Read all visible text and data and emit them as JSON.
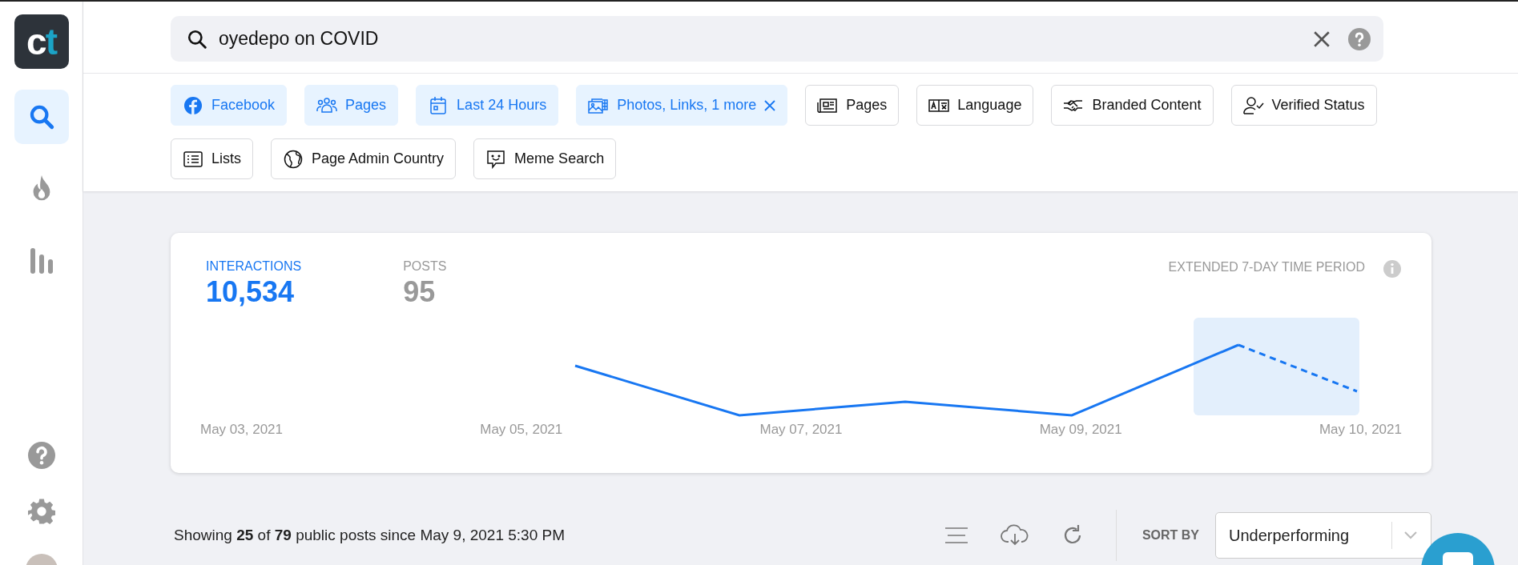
{
  "logo": {
    "letters": [
      {
        "text": "c",
        "color": "#ffffff"
      },
      {
        "text": "t",
        "color": "#1ba3c6"
      }
    ]
  },
  "sidebar": {
    "items": [
      {
        "kind": "search",
        "selected": true
      },
      {
        "kind": "trending",
        "selected": false
      },
      {
        "kind": "stats",
        "selected": false
      }
    ],
    "bottom_items": [
      {
        "kind": "help"
      },
      {
        "kind": "settings"
      },
      {
        "kind": "avatar"
      }
    ]
  },
  "search": {
    "value": "oyedepo on COVID"
  },
  "filters": [
    {
      "kind": "platform",
      "label": "Facebook",
      "selected": true,
      "removable": false
    },
    {
      "kind": "account-type",
      "label": "Pages",
      "selected": true,
      "removable": false
    },
    {
      "kind": "date",
      "label": "Last 24 Hours",
      "selected": true,
      "removable": false
    },
    {
      "kind": "media",
      "label": "Photos, Links, 1 more",
      "selected": true,
      "removable": true
    },
    {
      "kind": "pages",
      "label": "Pages",
      "selected": false,
      "removable": false
    },
    {
      "kind": "language",
      "label": "Language",
      "selected": false,
      "removable": false
    },
    {
      "kind": "branded",
      "label": "Branded Content",
      "selected": false,
      "removable": false
    },
    {
      "kind": "verified",
      "label": "Verified Status",
      "selected": false,
      "removable": false
    },
    {
      "kind": "lists",
      "label": "Lists",
      "selected": false,
      "removable": false
    },
    {
      "kind": "country",
      "label": "Page Admin Country",
      "selected": false,
      "removable": false
    },
    {
      "kind": "meme",
      "label": "Meme Search",
      "selected": false,
      "removable": false
    }
  ],
  "summary": {
    "stats": [
      {
        "label": "INTERACTIONS",
        "value": "10,534",
        "selected": true
      },
      {
        "label": "POSTS",
        "value": "95",
        "selected": false
      }
    ],
    "period_label": "EXTENDED 7-DAY TIME PERIOD",
    "dates": [
      "May 03, 2021",
      "May 05, 2021",
      "May 07, 2021",
      "May 09, 2021",
      "May 10, 2021"
    ]
  },
  "results": {
    "summary": "Showing **25** of **79** public posts since May 9, 2021 5:30 PM",
    "sort_label": "SORT BY",
    "sort_value": "Underperforming"
  }
}
